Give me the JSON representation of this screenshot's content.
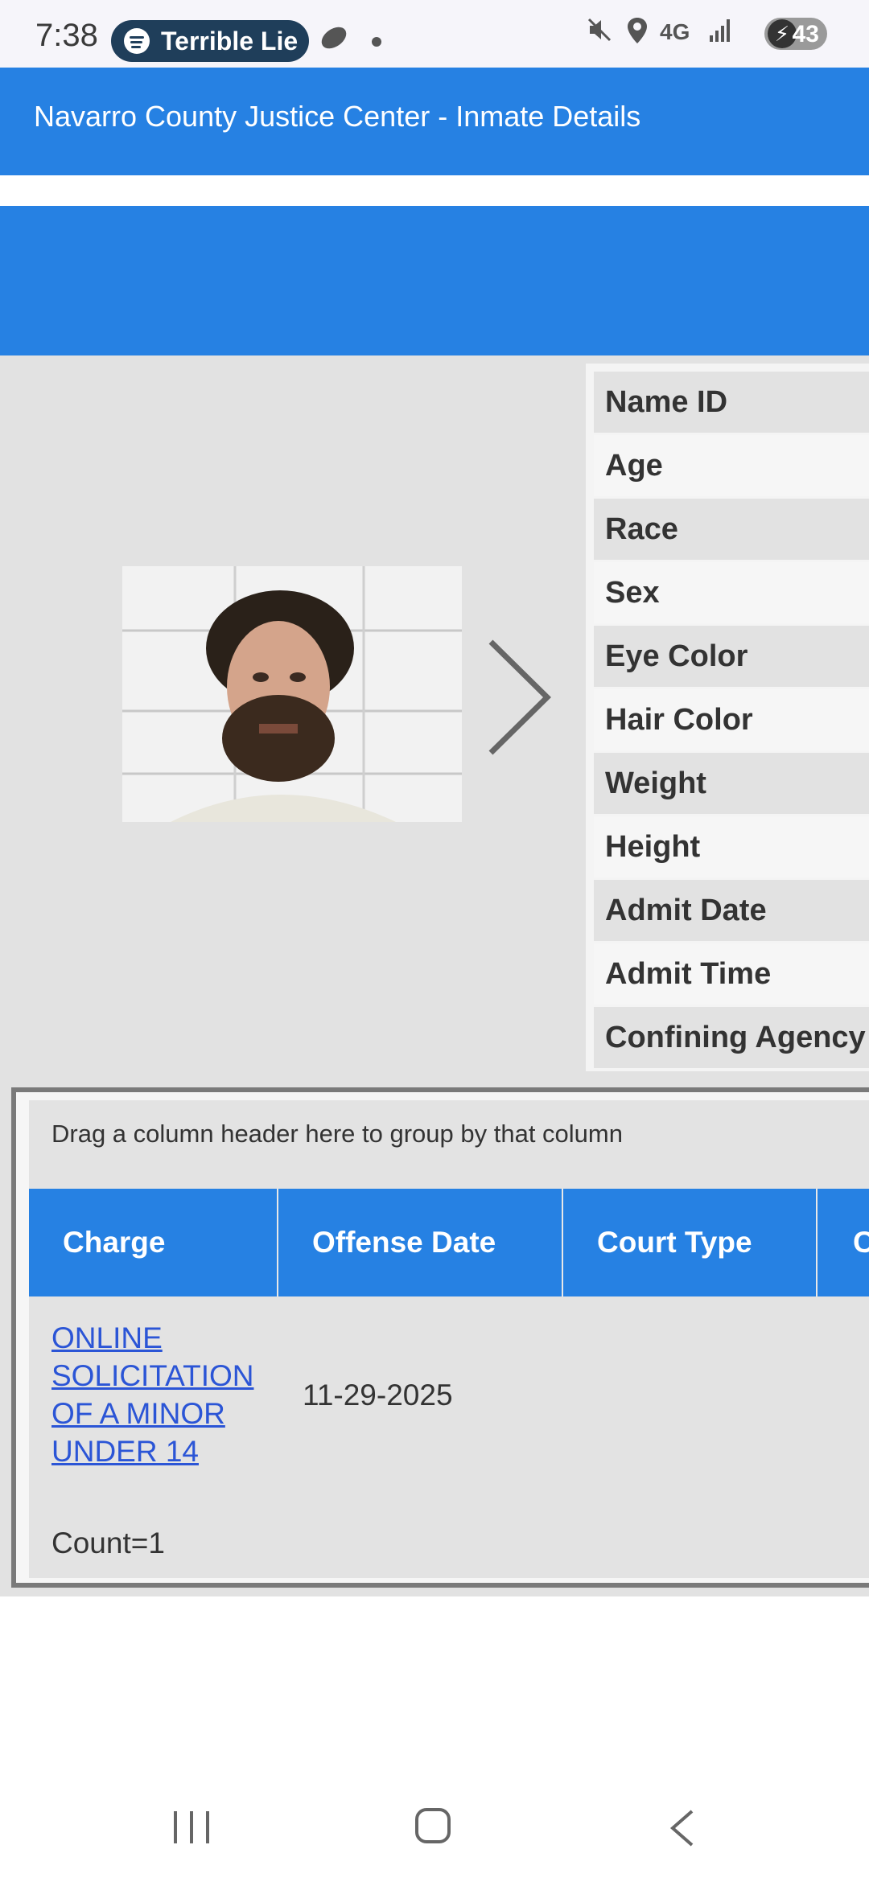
{
  "status_bar": {
    "time": "7:38",
    "media_app_icon": "spotify-icon",
    "media_title": "Terrible Lie",
    "network": "4G",
    "battery": "43"
  },
  "app_bar": {
    "title": "Navarro County Justice Center - Inmate Details"
  },
  "colors": {
    "primary": "#2681e3",
    "panel_bg": "#e2e2e2",
    "link": "#2b55d6"
  },
  "inmate": {
    "photo_alt": "mugshot-photo",
    "next_icon": "chevron-right-icon",
    "fields": [
      {
        "label": "Name ID"
      },
      {
        "label": "Age"
      },
      {
        "label": "Race"
      },
      {
        "label": "Sex"
      },
      {
        "label": "Eye Color"
      },
      {
        "label": "Hair Color"
      },
      {
        "label": "Weight"
      },
      {
        "label": "Height"
      },
      {
        "label": "Admit Date"
      },
      {
        "label": "Admit Time"
      },
      {
        "label": "Confining Agency"
      }
    ]
  },
  "charges_grid": {
    "group_hint": "Drag a column header here to group by that column",
    "columns": [
      "Charge",
      "Offense Date",
      "Court Type",
      "C"
    ],
    "rows": [
      {
        "charge": "ONLINE SOLICITATION OF A MINOR UNDER 14",
        "offense_date": "11-29-2025",
        "court_type": ""
      }
    ],
    "footer": "Count=1"
  }
}
